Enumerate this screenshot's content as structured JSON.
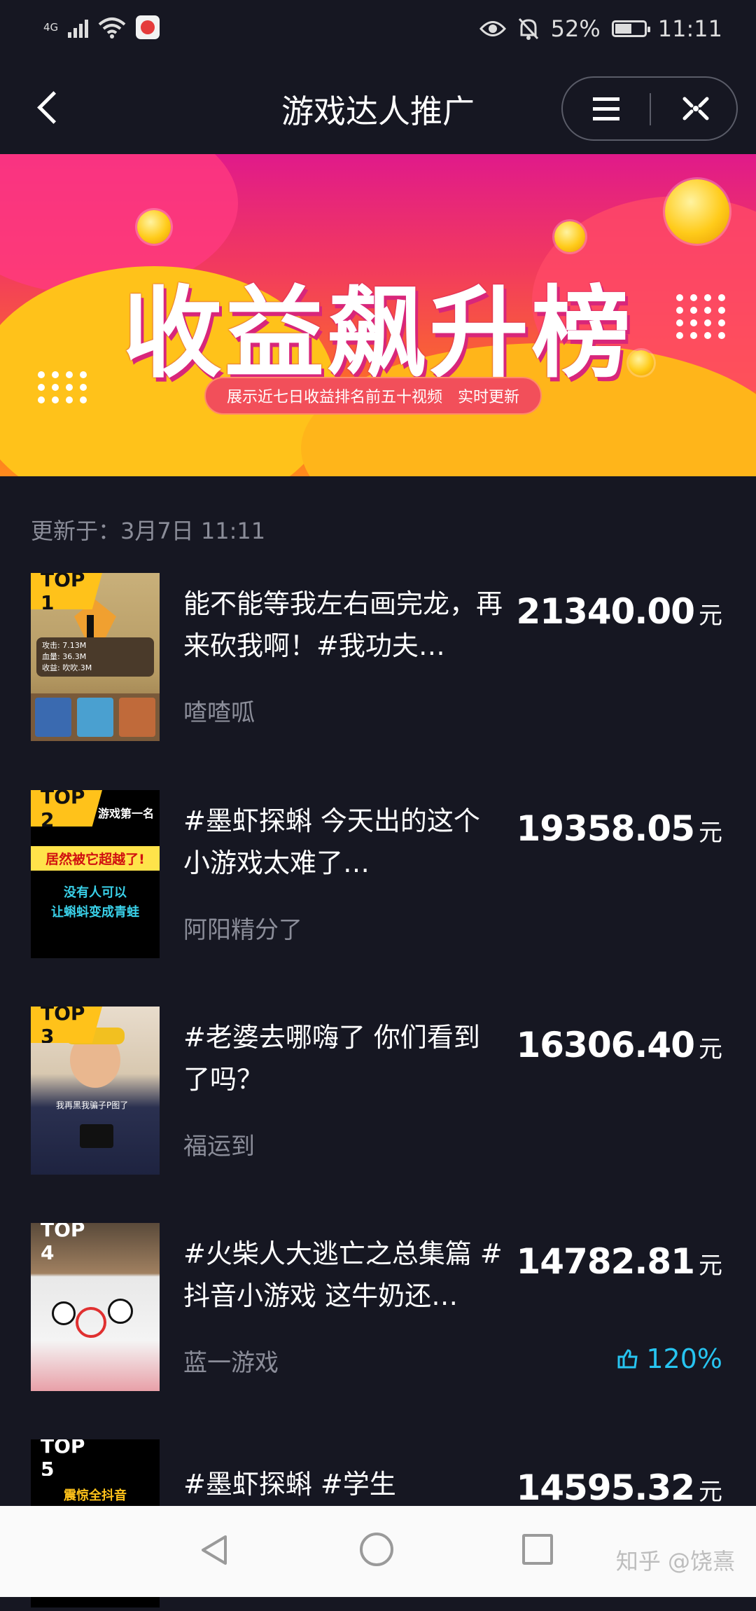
{
  "status": {
    "network": "4G",
    "battery": "52%",
    "time": "11:11"
  },
  "nav": {
    "title": "游戏达人推广"
  },
  "banner": {
    "title": "收益飙升榜",
    "subtitle": "展示近七日收益排名前五十视频　实时更新"
  },
  "updated": "更新于：3月7日 11:11",
  "items": [
    {
      "rank": "TOP 1",
      "title": "能不能等我左右画完龙，再来砍我啊！#我功夫…",
      "author": "喳喳呱",
      "amount": "21340.00",
      "unit": "元",
      "thumb_text": [
        "攻击: 7.13M",
        "血量: 36.3M",
        "收益: 吹吹.3M"
      ]
    },
    {
      "rank": "TOP 2",
      "title": "#墨虾探蝌 今天出的这个小游戏太难了…",
      "author": "阿阳精分了",
      "amount": "19358.05",
      "unit": "元",
      "thumb_text": [
        "游戏第一名",
        "居然被它超越了!",
        "没有人可以",
        "让蝌蚪变成青蛙"
      ]
    },
    {
      "rank": "TOP 3",
      "title": "#老婆去哪嗨了 你们看到了吗？",
      "author": "福运到",
      "amount": "16306.40",
      "unit": "元",
      "thumb_text": [
        "我再黑我骗子P图了"
      ]
    },
    {
      "rank": "TOP 4",
      "title": "#火柴人大逃亡之总集篇 #抖音小游戏 这牛奶还…",
      "author": "蓝一游戏",
      "amount": "14782.81",
      "unit": "元",
      "growth": "120%"
    },
    {
      "rank": "TOP 5",
      "title": "#墨虾探蝌 #学生",
      "author": "",
      "amount": "14595.32",
      "unit": "元",
      "thumb_text": [
        "震惊全抖音"
      ]
    }
  ],
  "watermark": "知乎 @饶熹",
  "colors": {
    "background": "#161722",
    "accent_badge": "#ffc21a",
    "growth": "#27c4f0"
  }
}
